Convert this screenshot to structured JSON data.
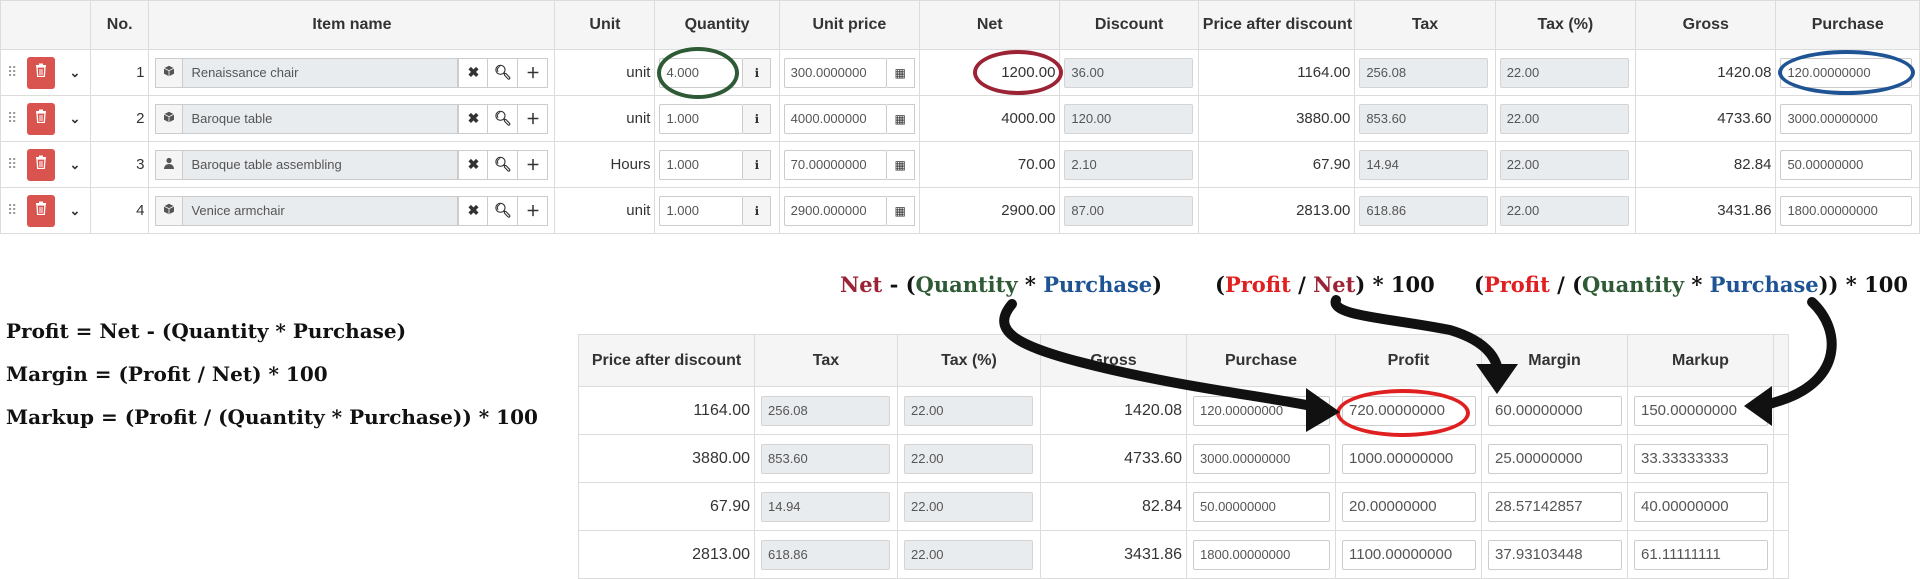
{
  "top_table": {
    "headers": [
      "No.",
      "Item name",
      "Unit",
      "Quantity",
      "Unit price",
      "Net",
      "Discount",
      "Price after discount",
      "Tax",
      "Tax (%)",
      "Gross",
      "Purchase"
    ],
    "rows": [
      {
        "no": "1",
        "item": "Renaissance chair",
        "unit": "unit",
        "quantity": "4.000",
        "unit_price": "300.0000000",
        "net": "1200.00",
        "discount": "36.00",
        "price_after_discount": "1164.00",
        "tax": "256.08",
        "tax_pct": "22.00",
        "gross": "1420.08",
        "purchase": "120.00000000",
        "item_icon": "cube-icon"
      },
      {
        "no": "2",
        "item": "Baroque table",
        "unit": "unit",
        "quantity": "1.000",
        "unit_price": "4000.000000",
        "net": "4000.00",
        "discount": "120.00",
        "price_after_discount": "3880.00",
        "tax": "853.60",
        "tax_pct": "22.00",
        "gross": "4733.60",
        "purchase": "3000.00000000",
        "item_icon": "cube-icon"
      },
      {
        "no": "3",
        "item": "Baroque table assembling",
        "unit": "Hours",
        "quantity": "1.000",
        "unit_price": "70.00000000",
        "net": "70.00",
        "discount": "2.10",
        "price_after_discount": "67.90",
        "tax": "14.94",
        "tax_pct": "22.00",
        "gross": "82.84",
        "purchase": "50.00000000",
        "item_icon": "person-icon"
      },
      {
        "no": "4",
        "item": "Venice armchair",
        "unit": "unit",
        "quantity": "1.000",
        "unit_price": "2900.000000",
        "net": "2900.00",
        "discount": "87.00",
        "price_after_discount": "2813.00",
        "tax": "618.86",
        "tax_pct": "22.00",
        "gross": "3431.86",
        "purchase": "1800.00000000",
        "item_icon": "cube-icon"
      }
    ]
  },
  "bottom_table": {
    "headers": [
      "Price after discount",
      "Tax",
      "Tax (%)",
      "Gross",
      "Purchase",
      "Profit",
      "Margin",
      "Markup"
    ],
    "rows": [
      {
        "price_after_discount": "1164.00",
        "tax": "256.08",
        "tax_pct": "22.00",
        "gross": "1420.08",
        "purchase": "120.00000000",
        "profit": "720.00000000",
        "margin": "60.00000000",
        "markup": "150.00000000"
      },
      {
        "price_after_discount": "3880.00",
        "tax": "853.60",
        "tax_pct": "22.00",
        "gross": "4733.60",
        "purchase": "3000.00000000",
        "profit": "1000.00000000",
        "margin": "25.00000000",
        "markup": "33.33333333"
      },
      {
        "price_after_discount": "67.90",
        "tax": "14.94",
        "tax_pct": "22.00",
        "gross": "82.84",
        "purchase": "50.00000000",
        "profit": "20.00000000",
        "margin": "28.57142857",
        "markup": "40.00000000"
      },
      {
        "price_after_discount": "2813.00",
        "tax": "618.86",
        "tax_pct": "22.00",
        "gross": "3431.86",
        "purchase": "1800.00000000",
        "profit": "1100.00000000",
        "margin": "37.93103448",
        "markup": "61.11111111"
      }
    ]
  },
  "formulas": {
    "profit": "Profit = Net - (Quantity * Purchase)",
    "margin": "Margin = (Profit / Net) * 100",
    "markup": "Markup = (Profit / (Quantity * Purchase)) * 100"
  },
  "header_formulas": {
    "profit": {
      "net": "Net",
      "minus": " - (",
      "quantity": "Quantity",
      "times": " * ",
      "purchase": "Purchase",
      "close": ")"
    },
    "margin": {
      "open": "(",
      "profit": "Profit",
      "slash": " / ",
      "net": "Net",
      "close": ") * 100"
    },
    "markup": {
      "open": "(",
      "profit": "Profit",
      "slash": " / (",
      "quantity": "Quantity",
      "times": " * ",
      "purchase": "Purchase",
      "close": ")) * 100"
    }
  },
  "icons": {
    "delete": "trash-icon",
    "expand": "chevron-down-icon",
    "drag": "drag-handle-icon",
    "info": "info-icon",
    "calc": "calculator-icon",
    "clear": "clear-icon",
    "search": "search-icon",
    "add": "plus-icon"
  },
  "colors": {
    "net": "#9b2335",
    "quantity": "#2e5a35",
    "purchase": "#1f5494",
    "profit": "#e02020",
    "delete_button": "#d9534f"
  }
}
